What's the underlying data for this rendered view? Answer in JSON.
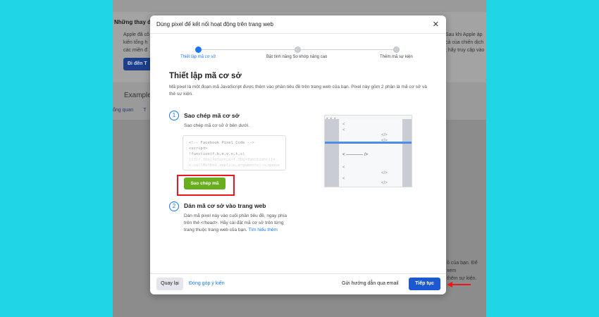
{
  "background": {
    "section_title": "Những thay đổ",
    "text_left": [
      "Apple đã cô",
      "kiến tổng h",
      "các miền đ"
    ],
    "text_right": [
      "Sau khi Apple áp",
      "cả của chiến dịch",
      ", hãy truy cập vào"
    ],
    "button_label": "Đi đến T",
    "example_label": "Example",
    "tab_label": "ổng quan",
    "tab_label_2": "T",
    "bottom_right_text": [
      "ồ của bạn. Để xem",
      "thêm sự kiện."
    ]
  },
  "modal": {
    "title": "Dùng pixel để kết nối hoạt động trên trang web",
    "close_label": "✕",
    "steps": [
      {
        "label": "Thiết lập mã cơ sở",
        "active": true
      },
      {
        "label": "Bật tính năng So khớp nâng cao",
        "active": false
      },
      {
        "label": "Thêm mã sự kiện",
        "active": false
      }
    ],
    "heading": "Thiết lập mã cơ sở",
    "description": "Mã pixel là một đoạn mã JavaScript được thêm vào phần tiêu đề trên trang web của bạn. Pixel này gồm 2 phần là mã cơ sở và thẻ sự kiện.",
    "step1": {
      "number": "1",
      "title": "Sao chép mã cơ sở",
      "text": "Sao chép mã cơ sở ở bên dưới.",
      "code_lines": [
        "<!-- Facebook Pixel Code -->",
        "<script>",
        "!function(f,b,e,v,n,t,s)",
        "{if(f.fbq)return;n=f.fbq=function(){n.",
        "n.callMethod.apply(n,arguments):n.queue"
      ],
      "copy_button": "Sao chép mã"
    },
    "step2": {
      "number": "2",
      "title": "Dán mã cơ sở vào trang web",
      "text": "Dán mã pixel này vào cuối phần tiêu đề, ngay phía trên thẻ </head>. Hãy cài đặt mã cơ sở trên từng trang thuộc trang web của bạn.",
      "link": "Tìm hiểu thêm"
    },
    "illustration": {
      "dots": "● ● ●",
      "lines": [
        "<",
        "</>",
        "<",
        "</>",
        "< ———— />",
        "<",
        "</>",
        "<",
        "</>"
      ]
    },
    "footer": {
      "back_button": "Quay lại",
      "feedback_link": "Đóng góp ý kiến",
      "email_link": "Gửi hướng dẫn qua email",
      "next_button": "Tiếp tục"
    }
  },
  "colors": {
    "accent": "#1877f2",
    "next_button": "#1b58d1",
    "copy_button": "#6aad1e",
    "highlight": "#e8181c",
    "outer_background": "#1fd5e6"
  }
}
